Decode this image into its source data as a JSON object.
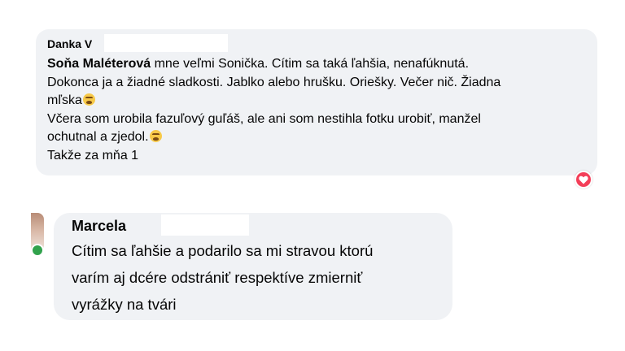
{
  "comment1": {
    "author": "Danka V",
    "mention": "Soňa Maléterová",
    "line1_rest": " mne veľmi Sonička. Cítim sa taká ľahšia, nenafúknutá.",
    "line2": "Dokonca ja a žiadné sladkosti. Jablko alebo hrušku. Oriešky. Večer nič. Žiadna",
    "line3": "mľska",
    "line4": "Včera som urobila fazuľový guľáš, ale ani som nestihla fotku urobiť, manžel",
    "line5": "ochutnal a zjedol.",
    "line6": "Takže za mňa 1",
    "emoji": "astonished-face-icon",
    "reaction": "heart-reaction-icon",
    "colors": {
      "bubble": "#f0f2f5",
      "reaction": "#f33e58"
    }
  },
  "comment2": {
    "author": "Marcela",
    "line1": "Cítim sa ľahšie a podarilo sa mi stravou ktorú",
    "line2": "varím aj dcére odstrániť respektíve zmierniť",
    "line3": "vyrážky na tvári",
    "online_color": "#31a24c"
  }
}
